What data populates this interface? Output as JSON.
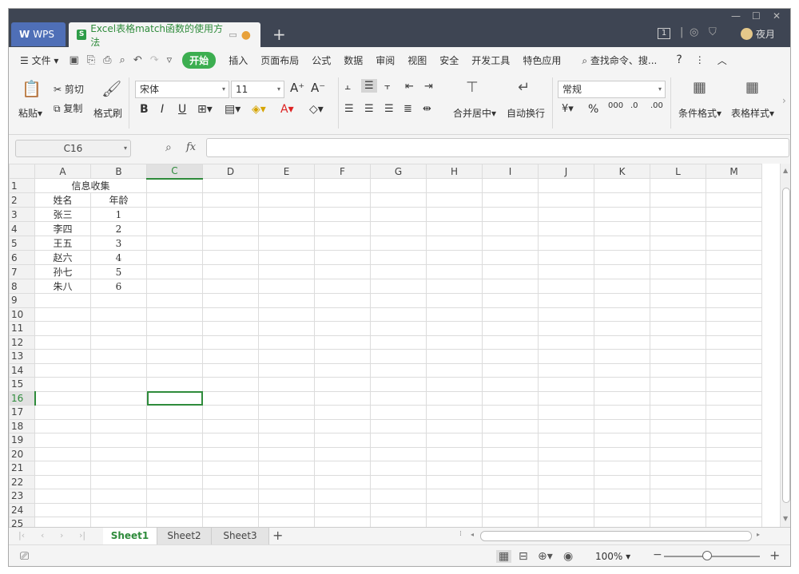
{
  "titlebar": {
    "app_tab": "WPS",
    "doc_tab": "Excel表格match函数的使用方法",
    "badge": "1",
    "user_name": "夜月"
  },
  "menu": {
    "file": "文件",
    "items": [
      "开始",
      "插入",
      "页面布局",
      "公式",
      "数据",
      "审阅",
      "视图",
      "安全",
      "开发工具",
      "特色应用"
    ],
    "search": "查找命令、搜...",
    "help": "?"
  },
  "ribbon": {
    "paste": "粘贴",
    "cut": "剪切",
    "copy": "复制",
    "format_painter": "格式刷",
    "font_name": "宋体",
    "font_size": "11",
    "merge_center": "合并居中",
    "wrap_text": "自动换行",
    "number_format": "常规",
    "conditional_format": "条件格式",
    "table_style": "表格样式",
    "bold": "B",
    "italic": "I",
    "underline": "U",
    "percent": "%"
  },
  "formula_bar": {
    "cell_ref": "C16",
    "fx": "fx",
    "value": ""
  },
  "grid": {
    "columns": [
      "A",
      "B",
      "C",
      "D",
      "E",
      "F",
      "G",
      "H",
      "I",
      "J",
      "K",
      "L",
      "M"
    ],
    "rows": [
      "1",
      "2",
      "3",
      "4",
      "5",
      "6",
      "7",
      "8",
      "9",
      "10",
      "11",
      "12",
      "13",
      "14",
      "15",
      "16",
      "17",
      "18",
      "19",
      "20",
      "21",
      "22",
      "23",
      "24",
      "25"
    ],
    "title_cell": "信息收集",
    "header": [
      "姓名",
      "年龄"
    ],
    "data": [
      [
        "张三",
        "1"
      ],
      [
        "李四",
        "2"
      ],
      [
        "王五",
        "3"
      ],
      [
        "赵六",
        "4"
      ],
      [
        "孙七",
        "5"
      ],
      [
        "朱八",
        "6"
      ]
    ],
    "selected_cell": "C16"
  },
  "sheets": {
    "tabs": [
      "Sheet1",
      "Sheet2",
      "Sheet3"
    ],
    "active": "Sheet1"
  },
  "status": {
    "zoom": "100%"
  }
}
